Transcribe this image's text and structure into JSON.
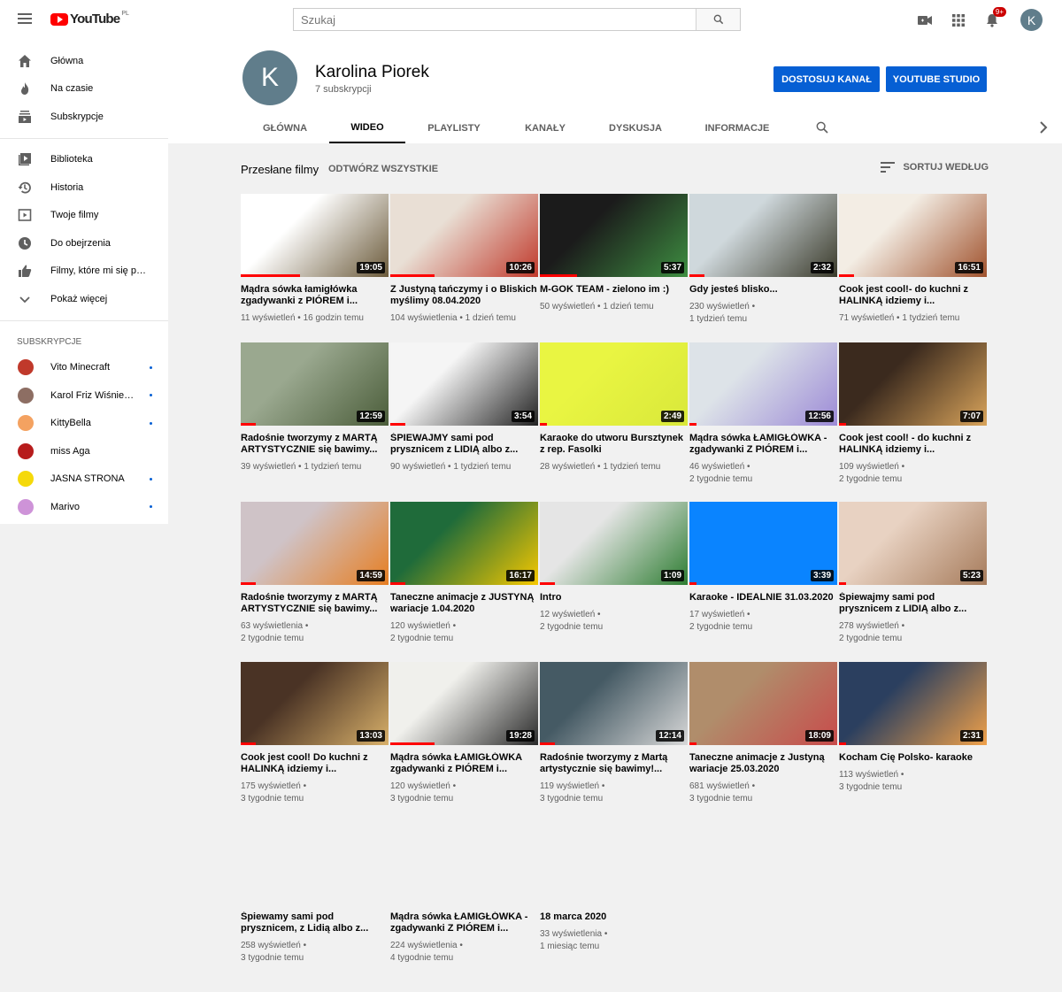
{
  "masthead": {
    "logo_text": "YouTube",
    "region": "PL",
    "search_placeholder": "Szukaj",
    "notif_count": "9+",
    "avatar_letter": "K"
  },
  "sidebar": {
    "main": [
      {
        "label": "Główna",
        "icon": "home-icon"
      },
      {
        "label": "Na czasie",
        "icon": "trending-icon"
      },
      {
        "label": "Subskrypcje",
        "icon": "subscriptions-icon"
      }
    ],
    "library": [
      {
        "label": "Biblioteka",
        "icon": "library-icon"
      },
      {
        "label": "Historia",
        "icon": "history-icon"
      },
      {
        "label": "Twoje filmy",
        "icon": "your-videos-icon"
      },
      {
        "label": "Do obejrzenia",
        "icon": "watch-later-icon"
      },
      {
        "label": "Filmy, które mi się podobają",
        "icon": "liked-icon"
      },
      {
        "label": "Pokaż więcej",
        "icon": "chevron-down-icon"
      }
    ],
    "subs_heading": "Subskrypcje",
    "subscriptions": [
      {
        "label": "Vito Minecraft",
        "color": "#c0392b",
        "dot": true
      },
      {
        "label": "Karol Friz Wiśniewski",
        "color": "#8d6e63",
        "dot": true
      },
      {
        "label": "KittyBella",
        "color": "#f4a261",
        "dot": true
      },
      {
        "label": "miss Aga",
        "color": "#b71c1c",
        "dot": false
      },
      {
        "label": "JASNA STRONA",
        "color": "#f5d90a",
        "dot": true
      },
      {
        "label": "Marivo",
        "color": "#ce93d8",
        "dot": true
      }
    ]
  },
  "channel": {
    "avatar_letter": "K",
    "name": "Karolina Piorek",
    "subscribers": "7 subskrypcji",
    "customize_label": "Dostosuj kanał",
    "studio_label": "YouTube Studio",
    "tabs": [
      "Główna",
      "Wideo",
      "Playlisty",
      "Kanały",
      "Dyskusja",
      "Informacje"
    ],
    "active_tab": "Wideo"
  },
  "section": {
    "title": "Przesłane filmy",
    "play_all": "Odtwórz wszystkie",
    "sort": "Sortuj według"
  },
  "videos": [
    {
      "title": "Mądra sówka łamigłówka zgadywanki z PIÓREM i...",
      "views": "11 wyświetleń",
      "age": "16 godzin temu",
      "duration": "19:05",
      "progress": 0.4,
      "c1": "#ffffff",
      "c2": "#6b5a3a",
      "meta_break": false
    },
    {
      "title": "Z Justyną tańczymy i o Bliskich myślimy 08.04.2020",
      "views": "104 wyświetlenia",
      "age": "1 dzień temu",
      "duration": "10:26",
      "progress": 0.3,
      "c1": "#e9dfd5",
      "c2": "#c0392b",
      "meta_break": false
    },
    {
      "title": "M-GOK TEAM - zielono im :)",
      "views": "50 wyświetleń",
      "age": "1 dzień temu",
      "duration": "5:37",
      "progress": 0.25,
      "c1": "#1b1b1b",
      "c2": "#3e8e41",
      "meta_break": false
    },
    {
      "title": "Gdy jesteś blisko...",
      "views": "230 wyświetleń",
      "age": "1 tydzień temu",
      "duration": "2:32",
      "progress": 0.1,
      "c1": "#cfd8dc",
      "c2": "#3a3a2a",
      "meta_break": true
    },
    {
      "title": "Cook jest cool!- do kuchni z HALINKĄ idziemy i...",
      "views": "71 wyświetleń",
      "age": "1 tydzień temu",
      "duration": "16:51",
      "progress": 0.1,
      "c1": "#f3ede4",
      "c2": "#a0522d",
      "meta_break": false
    },
    {
      "title": "Radośnie tworzymy z MARTĄ ARTYSTYCZNIE się bawimy...",
      "views": "39 wyświetleń",
      "age": "1 tydzień temu",
      "duration": "12:59",
      "progress": 0.1,
      "c1": "#9aa88f",
      "c2": "#4b5d3a",
      "meta_break": false
    },
    {
      "title": "ŚPIEWAJMY sami pod prysznicem z LIDIĄ albo z...",
      "views": "90 wyświetleń",
      "age": "1 tydzień temu",
      "duration": "3:54",
      "progress": 0.1,
      "c1": "#f5f5f5",
      "c2": "#222222",
      "meta_break": false
    },
    {
      "title": "Karaoke do utworu Bursztynek z rep. Fasolki",
      "views": "28 wyświetleń",
      "age": "1 tydzień temu",
      "duration": "2:49",
      "progress": 0.05,
      "c1": "#e9f542",
      "c2": "#d9e83a",
      "meta_break": false
    },
    {
      "title": "Mądra sówka ŁAMIGŁÓWKA - zgadywanki Z PIÓREM i...",
      "views": "46 wyświetleń",
      "age": "2 tygodnie temu",
      "duration": "12:56",
      "progress": 0.05,
      "c1": "#dde3e8",
      "c2": "#9c8ad6",
      "meta_break": true
    },
    {
      "title": "Cook jest cool! - do kuchni z HALINKĄ idziemy i...",
      "views": "109 wyświetleń",
      "age": "2 tygodnie temu",
      "duration": "7:07",
      "progress": 0.05,
      "c1": "#3b2a1e",
      "c2": "#d9a45b",
      "meta_break": true
    },
    {
      "title": "Radośnie tworzymy z MARTĄ ARTYSTYCZNIE się bawimy...",
      "views": "63 wyświetlenia",
      "age": "2 tygodnie temu",
      "duration": "14:59",
      "progress": 0.1,
      "c1": "#cfc3c7",
      "c2": "#e67e22",
      "meta_break": true
    },
    {
      "title": "Taneczne animacje z JUSTYNĄ wariacje 1.04.2020",
      "views": "120 wyświetleń",
      "age": "2 tygodnie temu",
      "duration": "16:17",
      "progress": 0.1,
      "c1": "#1f6b3a",
      "c2": "#f6c800",
      "meta_break": true
    },
    {
      "title": "Intro",
      "views": "12 wyświetleń",
      "age": "2 tygodnie temu",
      "duration": "1:09",
      "progress": 0.1,
      "c1": "#e5e5e5",
      "c2": "#2e7d32",
      "meta_break": true
    },
    {
      "title": "Karaoke - IDEALNIE 31.03.2020",
      "views": "17 wyświetleń",
      "age": "2 tygodnie temu",
      "duration": "3:39",
      "progress": 0.05,
      "c1": "#0a84ff",
      "c2": "#0a84ff",
      "meta_break": true
    },
    {
      "title": "Śpiewajmy sami pod prysznicem z LIDIĄ albo z...",
      "views": "278 wyświetleń",
      "age": "2 tygodnie temu",
      "duration": "5:23",
      "progress": 0.05,
      "c1": "#e8d2c2",
      "c2": "#a67b5b",
      "meta_break": true
    },
    {
      "title": "Cook jest cool! Do kuchni z HALINKĄ idziemy i...",
      "views": "175 wyświetleń",
      "age": "3 tygodnie temu",
      "duration": "13:03",
      "progress": 0.1,
      "c1": "#4a3325",
      "c2": "#d8b06a",
      "meta_break": true
    },
    {
      "title": "Mądra sówka ŁAMIGŁÓWKA zgadywanki z PIÓREM i...",
      "views": "120 wyświetleń",
      "age": "3 tygodnie temu",
      "duration": "19:28",
      "progress": 0.3,
      "c1": "#f0f0ec",
      "c2": "#2a2a2a",
      "meta_break": true
    },
    {
      "title": "Radośnie tworzymy z Martą artystycznie się bawimy!...",
      "views": "119 wyświetleń",
      "age": "3 tygodnie temu",
      "duration": "12:14",
      "progress": 0.1,
      "c1": "#455a64",
      "c2": "#d8d8d8",
      "meta_break": true
    },
    {
      "title": "Taneczne animacje z Justyną wariacje 25.03.2020",
      "views": "681 wyświetleń",
      "age": "3 tygodnie temu",
      "duration": "18:09",
      "progress": 0.05,
      "c1": "#b08d6b",
      "c2": "#c84b4b",
      "meta_break": true
    },
    {
      "title": "Kocham Cię Polsko- karaoke",
      "views": "113 wyświetleń",
      "age": "3 tygodnie temu",
      "duration": "2:31",
      "progress": 0.05,
      "c1": "#2b3f5f",
      "c2": "#f0a14a",
      "meta_break": true
    },
    {
      "title": "Śpiewamy sami pod prysznicem, z Lidią albo z...",
      "views": "258 wyświetleń",
      "age": "3 tygodnie temu",
      "duration": "",
      "progress": 0,
      "c1": "",
      "c2": "",
      "meta_break": true
    },
    {
      "title": "Mądra sówka ŁAMIGŁÓWKA - zgadywanki Z PIÓREM i...",
      "views": "224 wyświetlenia",
      "age": "4 tygodnie temu",
      "duration": "",
      "progress": 0,
      "c1": "",
      "c2": "",
      "meta_break": true
    },
    {
      "title": "18 marca 2020",
      "views": "33 wyświetlenia",
      "age": "1 miesiąc temu",
      "duration": "",
      "progress": 0,
      "c1": "",
      "c2": "",
      "meta_break": true
    }
  ]
}
